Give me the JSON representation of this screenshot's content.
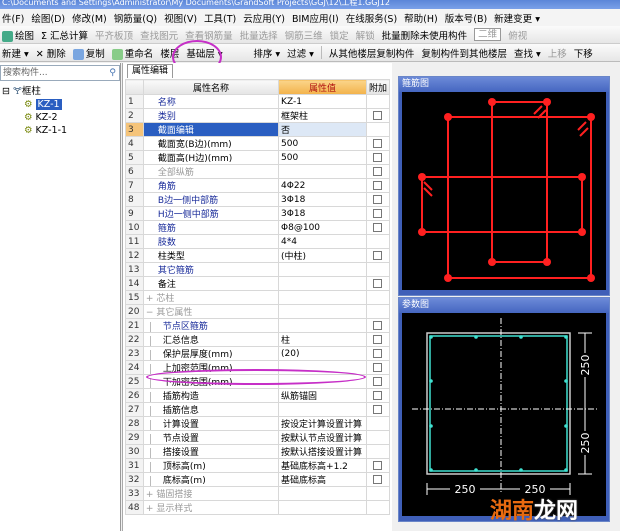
{
  "title": "C:\\Documents and Settings\\Administrator\\My Documents\\GrandSoft Projects\\GGJ\\12\\工程1.GGJ12",
  "menu": [
    "件(F)",
    "绘图(D)",
    "修改(M)",
    "钢筋量(Q)",
    "视图(V)",
    "工具(T)",
    "云应用(Y)",
    "BIM应用(I)",
    "在线服务(S)",
    "帮助(H)",
    "版本号(B)",
    "新建变更 ▾"
  ],
  "toolbar1": {
    "draw": "绘图",
    "sum": "Σ 汇总计算",
    "align": "平齐板顶",
    "find": "查找图元",
    "view_qty": "查看钢筋量",
    "batch_select": "批量选择",
    "rebar3d": "钢筋三维",
    "lock": "锁定",
    "unlock": "解锁",
    "batch_delete": "批量删除未使用构件",
    "view2d": "二维",
    "top_view": "俯视"
  },
  "toolbar2": {
    "new": "新建 ▾",
    "delete": "✕ 删除",
    "copy": "复制",
    "rename": "重命名",
    "floor_label": "楼层",
    "floor_value": "基础层",
    "sort": "排序 ▾",
    "filter": "过滤 ▾",
    "copy_from": "从其他楼层复制构件",
    "copy_to": "复制构件到其他楼层",
    "find": "查找 ▾",
    "up": "上移",
    "down": "下移"
  },
  "search": {
    "placeholder": "搜索构件..."
  },
  "tree": {
    "root": "框柱",
    "items": [
      "KZ-1",
      "KZ-2",
      "KZ-1-1"
    ]
  },
  "props": {
    "tab": "属性编辑",
    "headers": [
      "属性名称",
      "属性值",
      "附加"
    ],
    "rows": [
      {
        "n": "1",
        "name": "名称",
        "value": "KZ-1",
        "cls": "blue",
        "cb": false
      },
      {
        "n": "2",
        "name": "类别",
        "value": "框架柱",
        "cls": "blue",
        "cb": true
      },
      {
        "n": "3",
        "name": "截面编辑",
        "value": "否",
        "cls": "",
        "cb": false,
        "selected": true
      },
      {
        "n": "4",
        "name": "截面宽(B边)(mm)",
        "value": "500",
        "cls": "",
        "cb": true
      },
      {
        "n": "5",
        "name": "截面高(H边)(mm)",
        "value": "500",
        "cls": "",
        "cb": true
      },
      {
        "n": "6",
        "name": "全部纵筋",
        "value": "",
        "cls": "gray",
        "cb": true
      },
      {
        "n": "7",
        "name": "角筋",
        "value": "4Φ22",
        "cls": "blue",
        "cb": true
      },
      {
        "n": "8",
        "name": "B边一侧中部筋",
        "value": "3Φ18",
        "cls": "blue",
        "cb": true
      },
      {
        "n": "9",
        "name": "H边一侧中部筋",
        "value": "3Φ18",
        "cls": "blue",
        "cb": true
      },
      {
        "n": "10",
        "name": "箍筋",
        "value": "Φ8@100",
        "cls": "blue",
        "cb": true
      },
      {
        "n": "11",
        "name": "肢数",
        "value": "4*4",
        "cls": "blue",
        "cb": false
      },
      {
        "n": "12",
        "name": "柱类型",
        "value": "(中柱)",
        "cls": "",
        "cb": true
      },
      {
        "n": "13",
        "name": "其它箍筋",
        "value": "",
        "cls": "blue",
        "cb": false
      },
      {
        "n": "14",
        "name": "备注",
        "value": "",
        "cls": "",
        "cb": true
      },
      {
        "n": "15",
        "name": "+ 芯柱",
        "value": "",
        "cls": "gray",
        "cb": false,
        "group": true
      },
      {
        "n": "20",
        "name": "− 其它属性",
        "value": "",
        "cls": "gray",
        "cb": false,
        "group": true
      },
      {
        "n": "21",
        "name": "节点区箍筋",
        "value": "",
        "cls": "blue",
        "cb": true,
        "child": true
      },
      {
        "n": "22",
        "name": "汇总信息",
        "value": "柱",
        "cls": "",
        "cb": true,
        "child": true
      },
      {
        "n": "23",
        "name": "保护层厚度(mm)",
        "value": "(20)",
        "cls": "",
        "cb": true,
        "child": true
      },
      {
        "n": "24",
        "name": "上加密范围(mm)",
        "value": "",
        "cls": "",
        "cb": true,
        "child": true
      },
      {
        "n": "25",
        "name": "下加密范围(mm)",
        "value": "",
        "cls": "",
        "cb": true,
        "child": true
      },
      {
        "n": "26",
        "name": "插筋构造",
        "value": "纵筋锚固",
        "cls": "",
        "cb": true,
        "child": true
      },
      {
        "n": "27",
        "name": "插筋信息",
        "value": "",
        "cls": "",
        "cb": true,
        "child": true
      },
      {
        "n": "28",
        "name": "计算设置",
        "value": "按设定计算设置计算",
        "cls": "",
        "cb": false,
        "child": true
      },
      {
        "n": "29",
        "name": "节点设置",
        "value": "按默认节点设置计算",
        "cls": "",
        "cb": false,
        "child": true
      },
      {
        "n": "30",
        "name": "搭接设置",
        "value": "按默认搭接设置计算",
        "cls": "",
        "cb": false,
        "child": true
      },
      {
        "n": "31",
        "name": "顶标高(m)",
        "value": "基础底标高+1.2",
        "cls": "",
        "cb": true,
        "child": true
      },
      {
        "n": "32",
        "name": "底标高(m)",
        "value": "基础底标高",
        "cls": "",
        "cb": true,
        "child": true
      },
      {
        "n": "33",
        "name": "+ 锚固搭接",
        "value": "",
        "cls": "gray",
        "cb": false,
        "group": true
      },
      {
        "n": "48",
        "name": "+ 显示样式",
        "value": "",
        "cls": "gray",
        "cb": false,
        "group": true
      }
    ]
  },
  "rebar_window": {
    "title": "箍筋图"
  },
  "param_window": {
    "title": "参数图",
    "dims": [
      "250",
      "250",
      "250",
      "250"
    ]
  },
  "watermark": {
    "a": "湖南",
    "b": "龙网"
  },
  "colors": {
    "rebar": "#ff2020",
    "param": "#40e0d0",
    "accent": "#c62fc7"
  }
}
